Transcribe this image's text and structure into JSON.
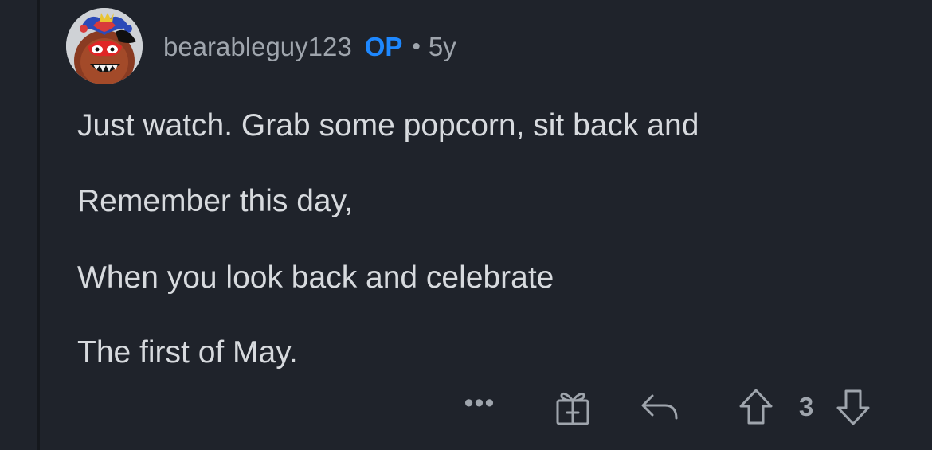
{
  "comment": {
    "author": "bearableguy123",
    "op_badge": "OP",
    "separator": "•",
    "age": "5y",
    "body_lines": [
      "Just watch.  Grab some popcorn, sit back and",
      "Remember this day,",
      "When you look back and celebrate",
      "The first of May."
    ],
    "actions": {
      "more_label": "•••",
      "score": "3"
    }
  },
  "icons": {
    "avatar": "avatar-image",
    "more": "more-icon",
    "award": "gift-icon",
    "reply": "reply-icon",
    "upvote": "upvote-icon",
    "downvote": "downvote-icon"
  },
  "colors": {
    "background": "#1f232b",
    "text": "#d7dade",
    "muted": "#9fa5ad",
    "op_badge": "#1e88ff"
  }
}
